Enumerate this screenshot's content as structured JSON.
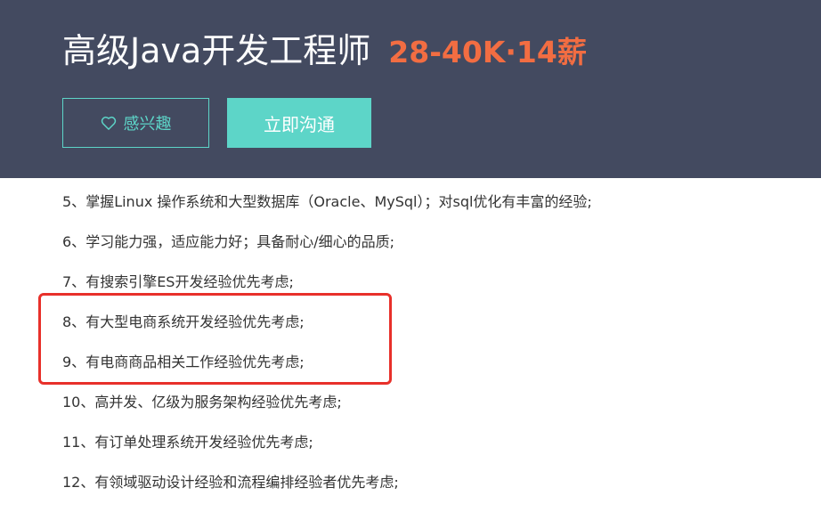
{
  "header": {
    "job_title": "高级Java开发工程师",
    "salary": "28-40K·14薪",
    "interest_button": {
      "icon": "heart-outline-icon",
      "label": "感兴趣"
    },
    "chat_button": {
      "label": "立即沟通"
    },
    "colors": {
      "background": "#434a60",
      "accent": "#5dd5c8",
      "salary": "#f26d42"
    }
  },
  "requirements": [
    {
      "num": "5、",
      "text": "掌握Linux 操作系统和大型数据库（Oracle、MySql）；对sql优化有丰富的经验;"
    },
    {
      "num": "6、",
      "text": "学习能力强，适应能力好；具备耐心/细心的品质;"
    },
    {
      "num": "7、",
      "text": "有搜索引擎ES开发经验优先考虑;"
    },
    {
      "num": "8、",
      "text": "有大型电商系统开发经验优先考虑;"
    },
    {
      "num": "9、",
      "text": "有电商商品相关工作经验优先考虑;"
    },
    {
      "num": "10、",
      "text": "高并发、亿级为服务架构经验优先考虑;"
    },
    {
      "num": "11、",
      "text": "有订单处理系统开发经验优先考虑;"
    },
    {
      "num": "12、",
      "text": "有领域驱动设计经验和流程编排经验者优先考虑;"
    }
  ],
  "annotation": {
    "color": "#e8302a"
  }
}
